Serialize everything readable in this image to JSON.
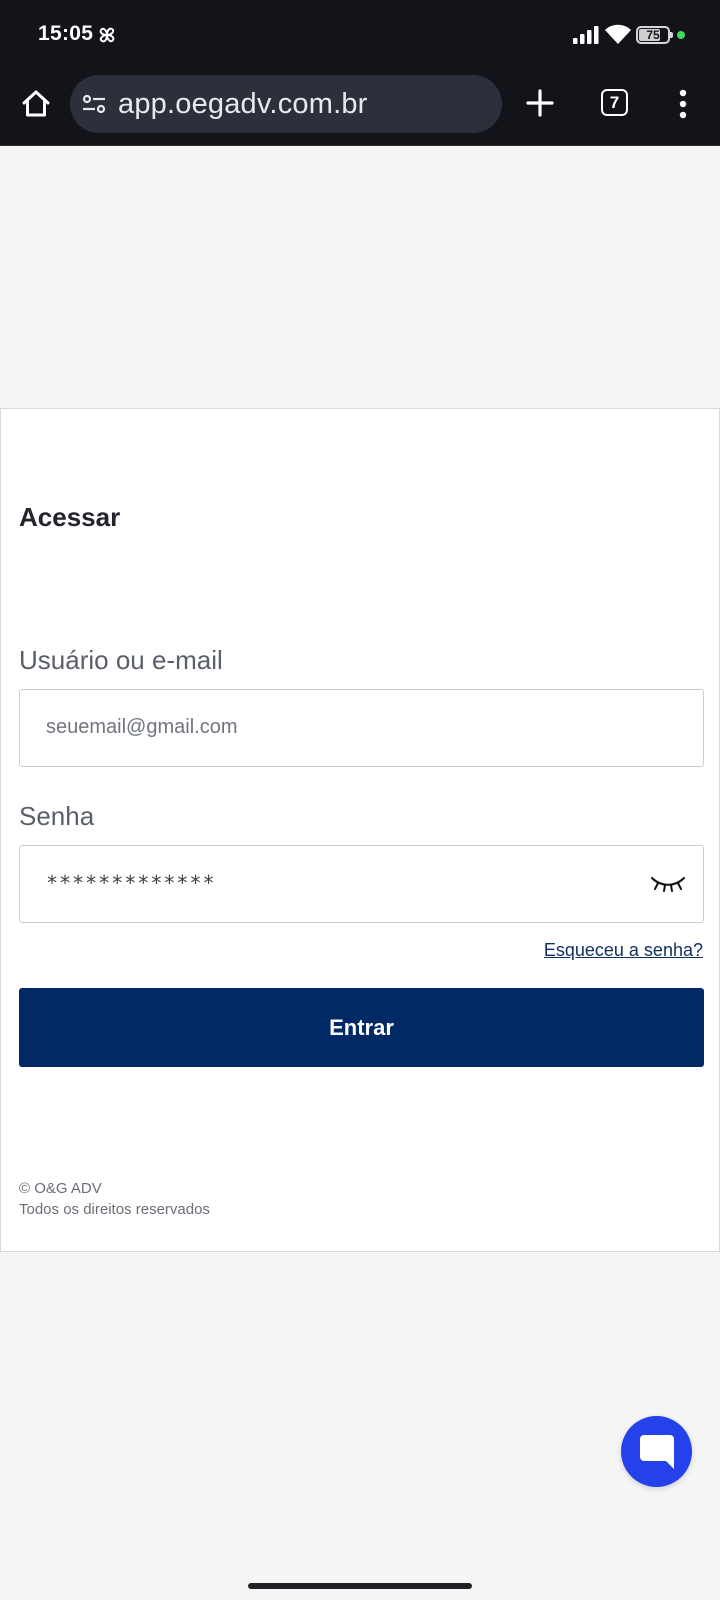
{
  "status_bar": {
    "time": "15:05",
    "battery": 75,
    "battery_label": "75",
    "icons": [
      "pinwheel-icon",
      "signal-icon",
      "wifi-icon",
      "battery-icon"
    ],
    "dot_color": "#3ddc5b"
  },
  "browser": {
    "url": "app.oegadv.com.br",
    "tab_count": "7",
    "icons": [
      "home-icon",
      "tune-icon",
      "plus-icon",
      "more-vert-icon"
    ]
  },
  "login": {
    "title": "Acessar",
    "user_label": "Usuário ou e-mail",
    "user_value": "seuemail@gmail.com",
    "password_label": "Senha",
    "password_value": "*************",
    "forgot_link": "Esqueceu a senha?",
    "submit_label": "Entrar",
    "submit_color": "#002966",
    "footer_copyright": "© O&G ADV",
    "footer_rights": "Todos os direitos reservados"
  },
  "chat": {
    "icon": "chat-bubble-icon",
    "color": "#2541ea"
  }
}
